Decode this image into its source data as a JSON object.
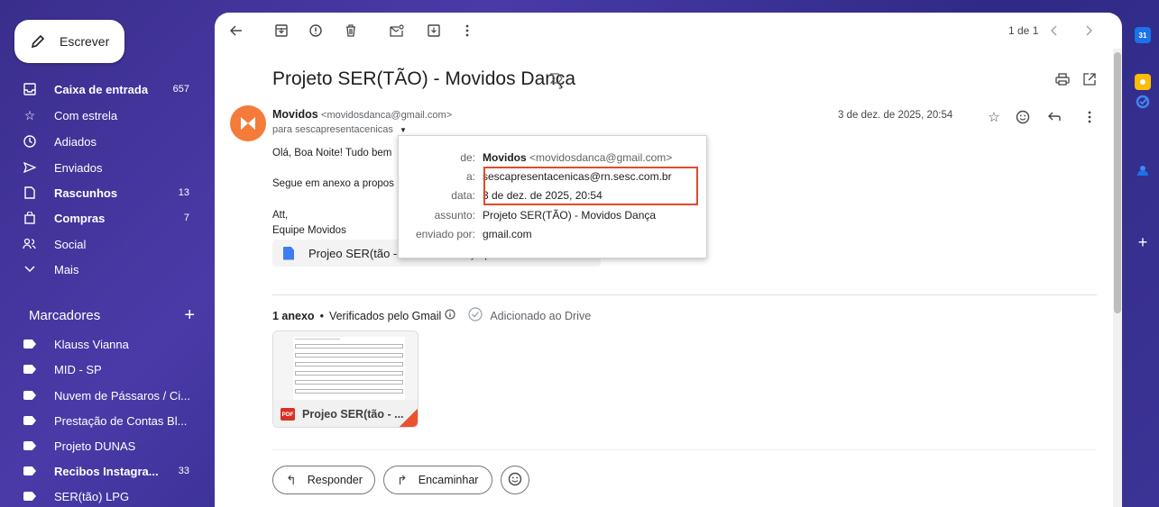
{
  "sidebar": {
    "compose_label": "Escrever",
    "items": [
      {
        "label": "Caixa de entrada",
        "count": "657",
        "icon": "inbox-icon",
        "bold": true
      },
      {
        "label": "Com estrela",
        "count": "",
        "icon": "star-icon",
        "bold": false
      },
      {
        "label": "Adiados",
        "count": "",
        "icon": "clock-icon",
        "bold": false
      },
      {
        "label": "Enviados",
        "count": "",
        "icon": "send-icon",
        "bold": false
      },
      {
        "label": "Rascunhos",
        "count": "13",
        "icon": "draft-icon",
        "bold": true
      },
      {
        "label": "Compras",
        "count": "7",
        "icon": "shopping-icon",
        "bold": true
      },
      {
        "label": "Social",
        "count": "",
        "icon": "people-icon",
        "bold": false
      },
      {
        "label": "Mais",
        "count": "",
        "icon": "chevron-down-icon",
        "bold": false
      }
    ],
    "labels_title": "Marcadores",
    "labels": [
      {
        "label": "Klauss Vianna",
        "count": "",
        "bold": false
      },
      {
        "label": "MID - SP",
        "count": "",
        "bold": false
      },
      {
        "label": "Nuvem de Pássaros / Ci...",
        "count": "",
        "bold": false
      },
      {
        "label": "Prestação de Contas Bl...",
        "count": "",
        "bold": false
      },
      {
        "label": "Projeto DUNAS",
        "count": "",
        "bold": false
      },
      {
        "label": "Recibos Instagra...",
        "count": "33",
        "bold": true
      },
      {
        "label": "SER(tão) LPG",
        "count": "",
        "bold": false
      }
    ]
  },
  "toolbar": {
    "pager": "1 de 1"
  },
  "email": {
    "subject": "Projeto SER(TÃO) - Movidos Dança",
    "sender_name": "Movidos",
    "sender_addr": "<movidosdanca@gmail.com>",
    "to_line": "para sescapresentacenicas",
    "date": "3 de dez. de 2025, 20:54",
    "body_lines": [
      "Olá, Boa Noite! Tudo bem",
      "Segue em anexo a propos",
      "Att,",
      "Equipe Movidos"
    ],
    "attachment_name": "Projeo SER(tão - Movidos Dança.pdf",
    "attach_count": "1 anexo",
    "attach_verified": "Verificados pelo Gmail",
    "attach_drive": "Adicionado ao Drive",
    "thumb_name": "Projeo SER(tão - ...",
    "pdf_badge": "PDF",
    "reply_label": "Responder",
    "forward_label": "Encaminhar"
  },
  "popup": {
    "rows": [
      {
        "key": "de:",
        "value_bold": "Movidos",
        "value": "<movidosdanca@gmail.com>"
      },
      {
        "key": "a:",
        "value_bold": "",
        "value": "sescapresentacenicas@rn.sesc.com.br"
      },
      {
        "key": "data:",
        "value_bold": "",
        "value": "3 de dez. de 2025, 20:54"
      },
      {
        "key": "assunto:",
        "value_bold": "",
        "value": "Projeto SER(TÃO) - Movidos Dança"
      },
      {
        "key": "enviado por:",
        "value_bold": "",
        "value": "gmail.com"
      }
    ]
  },
  "rightpanel": {
    "calendar_badge": "31"
  },
  "colors": {
    "accent_highlight": "#e04a2b",
    "avatar": "#f47b3a"
  }
}
